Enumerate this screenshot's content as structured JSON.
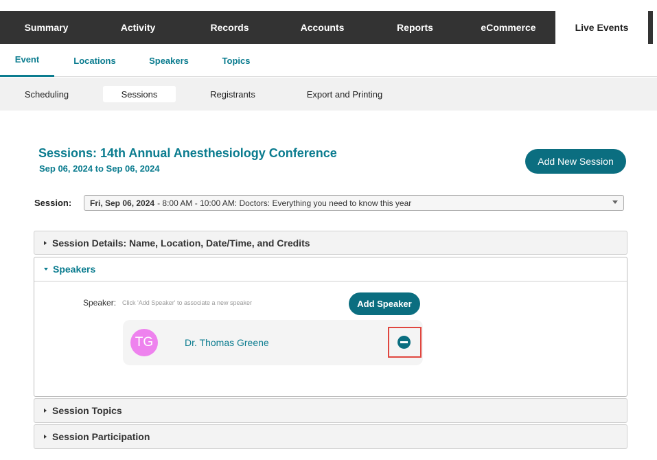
{
  "top_nav": {
    "tabs": [
      {
        "label": "Summary"
      },
      {
        "label": "Activity"
      },
      {
        "label": "Records"
      },
      {
        "label": "Accounts"
      },
      {
        "label": "Reports"
      },
      {
        "label": "eCommerce"
      },
      {
        "label": "Live Events",
        "active": true
      }
    ]
  },
  "sub_nav": {
    "tabs": [
      {
        "label": "Event",
        "active": true
      },
      {
        "label": "Locations"
      },
      {
        "label": "Speakers"
      },
      {
        "label": "Topics"
      }
    ]
  },
  "third_nav": {
    "tabs": [
      {
        "label": "Scheduling"
      },
      {
        "label": "Sessions",
        "active": true
      },
      {
        "label": "Registrants"
      },
      {
        "label": "Export and Printing"
      }
    ]
  },
  "page": {
    "title": "Sessions: 14th Annual Anesthesiology Conference",
    "dates": "Sep 06, 2024 to Sep 06, 2024",
    "add_session_label": "Add New Session"
  },
  "session_select": {
    "label": "Session:",
    "selected_date": "Fri, Sep 06, 2024",
    "selected_rest": " - 8:00 AM - 10:00 AM: Doctors: Everything you need to know this year"
  },
  "panels": {
    "details": {
      "title": "Session Details: Name, Location, Date/Time, and Credits"
    },
    "speakers": {
      "title": "Speakers",
      "speaker_label": "Speaker:",
      "hint": "Click 'Add Speaker' to associate a new speaker",
      "add_speaker_label": "Add Speaker",
      "items": [
        {
          "initials": "TG",
          "name": "Dr. Thomas Greene",
          "avatar_color": "#ee82ee"
        }
      ]
    },
    "topics": {
      "title": "Session Topics"
    },
    "participation": {
      "title": "Session Participation"
    }
  },
  "colors": {
    "accent": "#0b7c8f",
    "button": "#0b6e80",
    "topbar": "#333333",
    "highlight": "#e0463f"
  },
  "icons": [
    "remove-icon",
    "caret-down-icon",
    "chevron-right-icon",
    "chevron-down-icon"
  ]
}
